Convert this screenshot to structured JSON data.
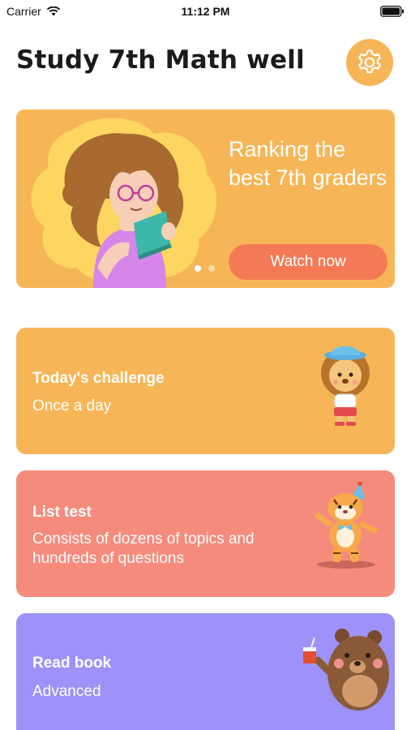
{
  "status_bar": {
    "carrier": "Carrier",
    "time": "11:12 PM"
  },
  "header": {
    "title": "Study 7th Math well",
    "settings_icon": "gear-icon"
  },
  "banner": {
    "title": "Ranking the best 7th graders",
    "button_label": "Watch now",
    "page_count": 2,
    "active_page": 1,
    "illustration": "girl-reading-book"
  },
  "cards": [
    {
      "title": "Today's challenge",
      "subtitle": "Once a day",
      "illustration": "lion-mascot"
    },
    {
      "title": "List test",
      "subtitle": "Consists of dozens of topics and hundreds of questions",
      "illustration": "tiger-mascot"
    },
    {
      "title": "Read book",
      "subtitle": "Advanced",
      "illustration": "bear-mascot"
    }
  ],
  "colors": {
    "orange": "#F6B657",
    "coral": "#F58B7C",
    "purple": "#9C92F8",
    "button": "#F47A55"
  }
}
